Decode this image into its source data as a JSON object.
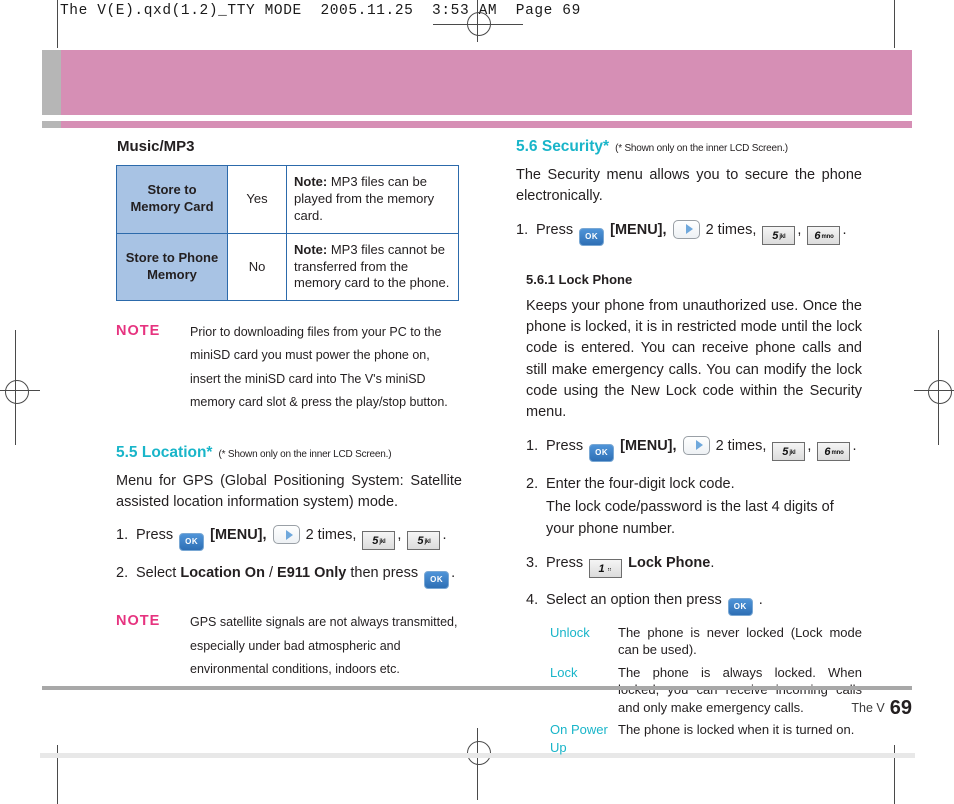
{
  "print": {
    "slug": "The V(E).qxd(1.2)_TTY MODE  2005.11.25  3:53 AM  Page 69"
  },
  "colors": {
    "accent_teal": "#19b5c9",
    "banner_pink": "#d68fb5",
    "banner_gray": "#b6b6b6",
    "note_magenta": "#e6337f",
    "table_header_blue": "#a8c3e4",
    "table_border_blue": "#2c6aab",
    "key_blue": "#2e6fb5"
  },
  "footer": {
    "device": "The V",
    "page_number": "69"
  },
  "left_column": {
    "heading": "Music/MP3",
    "table": {
      "rows": [
        {
          "label": "Store to\nMemory Card",
          "value": "Yes",
          "note_label": "Note:",
          "note_text": " MP3 files can be played from the memory card."
        },
        {
          "label": "Store to Phone\nMemory",
          "value": "No",
          "note_label": "Note:",
          "note_text": " MP3 files cannot be transferred from the memory card to the phone."
        }
      ]
    },
    "note1": {
      "tag": "NOTE",
      "text": "Prior to downloading files from your PC to the miniSD card you must power the phone on, insert the miniSD card into The V's miniSD memory card slot & press the play/stop button."
    },
    "section": {
      "title": "5.5 Location*",
      "footnote": "(* Shown only on the inner LCD Screen.)",
      "paragraph": "Menu for GPS (Global Positioning System: Satellite assisted location information system) mode.",
      "steps": [
        {
          "n": "1.",
          "pre": "Press",
          "menu_label": "[MENU],",
          "times": "2 times,",
          "keys": [
            "5",
            "5"
          ],
          "key_letters": [
            "jkl",
            "jkl"
          ]
        },
        {
          "n": "2.",
          "pre": "Select",
          "bold1": "Location On",
          "sep": " / ",
          "bold2": "E911 Only",
          "post": " then press",
          "tail": "."
        }
      ]
    },
    "note2": {
      "tag": "NOTE",
      "text": "GPS satellite signals are not always transmitted, especially under bad atmospheric and environmental conditions, indoors etc."
    }
  },
  "right_column": {
    "section": {
      "title": "5.6 Security*",
      "footnote": "(* Shown only on the inner LCD Screen.)",
      "paragraph": "The Security menu allows you to secure the phone electronically.",
      "step1": {
        "n": "1.",
        "pre": "Press",
        "menu_label": "[MENU],",
        "times": "2 times,",
        "keys": [
          "5",
          "6"
        ],
        "key_letters": [
          "jkl",
          "mno"
        ]
      }
    },
    "subsection": {
      "title": "5.6.1 Lock Phone",
      "paragraph": "Keeps your phone from unauthorized use. Once the phone is locked, it is in restricted mode until the lock code is entered. You can receive phone calls and still make emergency calls. You can modify the lock code using the New Lock code within the Security menu.",
      "steps": [
        {
          "n": "1.",
          "pre": "Press",
          "menu_label": "[MENU],",
          "times": "2 times,",
          "keys": [
            "5",
            "6"
          ],
          "key_letters": [
            "jkl",
            "mno"
          ]
        },
        {
          "n": "2.",
          "line1": "Enter the four-digit lock code.",
          "line2": "The lock code/password is the last 4 digits of your phone number."
        },
        {
          "n": "3.",
          "pre": "Press",
          "key": "1",
          "bold": "Lock Phone",
          "tail": "."
        },
        {
          "n": "4.",
          "pre": "Select an option then press",
          "tail": "."
        }
      ],
      "options": [
        {
          "term": "Unlock",
          "def": "The phone is never locked (Lock mode can be used)."
        },
        {
          "term": "Lock",
          "def": "The phone is always locked. When locked, you can receive incoming calls and only make emergency calls."
        },
        {
          "term": "On Power Up",
          "def": "The phone is locked when it is turned on."
        }
      ]
    }
  }
}
